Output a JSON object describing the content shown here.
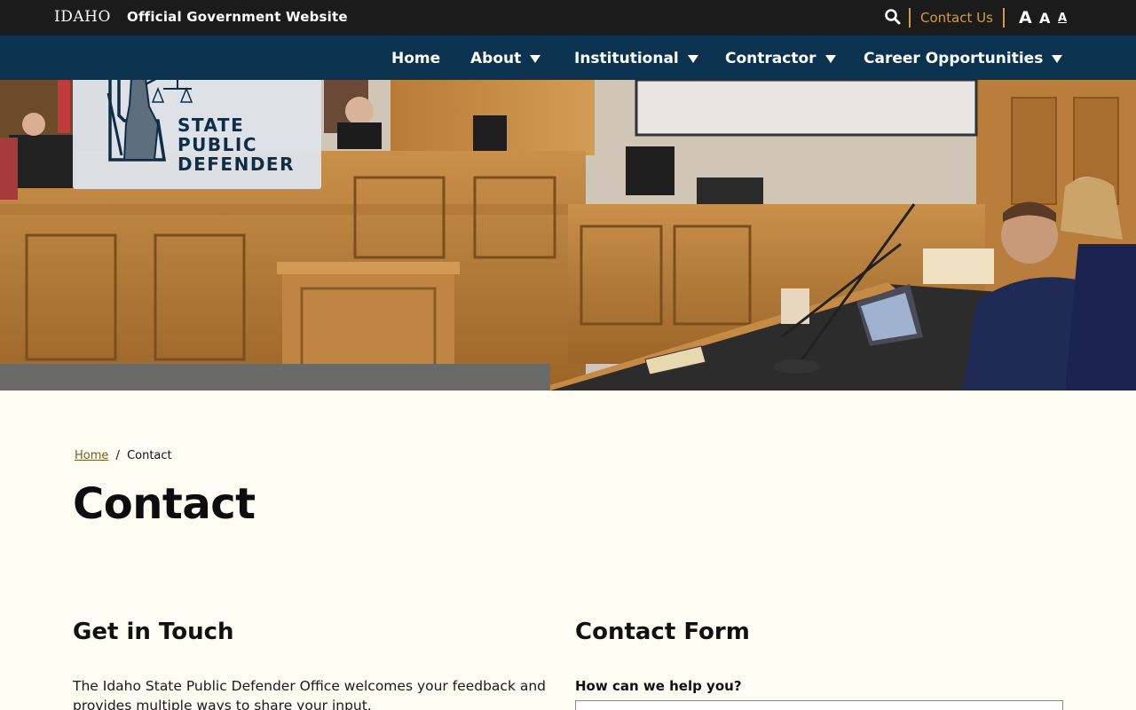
{
  "topbar": {
    "state_logo": "IDAHO",
    "official_label": "Official Government Website",
    "search_icon": "search-icon",
    "contact_us": "Contact Us",
    "font_size_large": "A",
    "font_size_medium": "A",
    "font_size_small": "A"
  },
  "nav": {
    "items": [
      {
        "label": "Home",
        "has_dropdown": false
      },
      {
        "label": "About",
        "has_dropdown": true
      },
      {
        "label": "Institutional",
        "has_dropdown": true
      },
      {
        "label": "Contractor",
        "has_dropdown": true
      },
      {
        "label": "Career Opportunities",
        "has_dropdown": true
      }
    ]
  },
  "hero": {
    "logo_lines": [
      "STATE",
      "PUBLIC",
      "DEFENDER"
    ],
    "image_description_icon": "courtroom-photo"
  },
  "breadcrumb": {
    "home": "Home",
    "separator": "/",
    "current": "Contact"
  },
  "page": {
    "title": "Contact"
  },
  "get_in_touch": {
    "heading": "Get in Touch",
    "text": "The Idaho State Public Defender Office welcomes your feedback and provides multiple ways to share your input."
  },
  "contact_form": {
    "heading": "Contact Form",
    "help_label": "How can we help you?"
  },
  "colors": {
    "topbar_bg": "#1b1b1b",
    "nav_bg": "#0b3350",
    "accent": "#d89a3c",
    "page_bg": "#fdfdf4"
  }
}
